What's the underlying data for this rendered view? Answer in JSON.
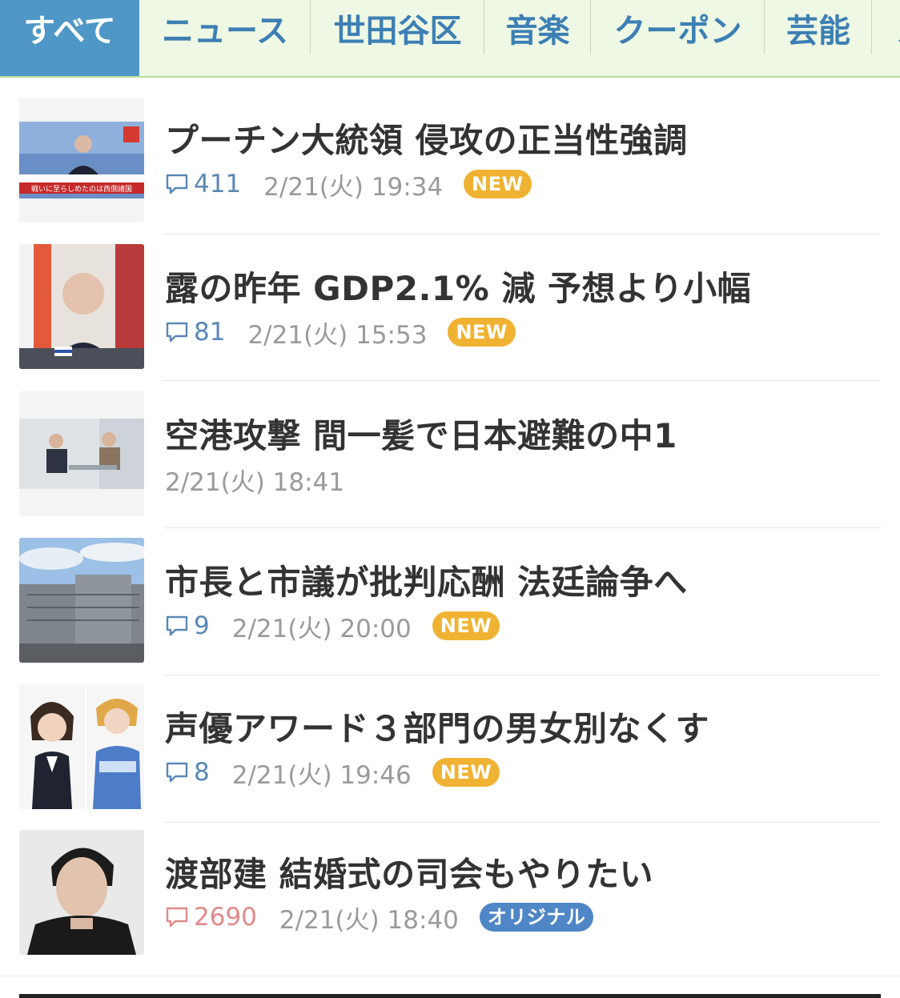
{
  "tabs": [
    {
      "label": "すべて",
      "active": true
    },
    {
      "label": "ニュース"
    },
    {
      "label": "世田谷区"
    },
    {
      "label": "音楽"
    },
    {
      "label": "クーポン"
    },
    {
      "label": "芸能"
    },
    {
      "label": "ス"
    }
  ],
  "articles": [
    {
      "title": "プーチン大統領 侵攻の正当性強調",
      "comments": "411",
      "date": "2/21(火) 19:34",
      "badge": "NEW",
      "thumb_caption": "戦いに至らしめたのは西側諸国"
    },
    {
      "title": "露の昨年 GDP2.1% 減 予想より小幅",
      "comments": "81",
      "date": "2/21(火) 15:53",
      "badge": "NEW"
    },
    {
      "title": "空港攻撃 間一髪で日本避難の中1",
      "comments": "",
      "date": "2/21(火) 18:41",
      "badge": ""
    },
    {
      "title": "市長と市議が批判応酬 法廷論争へ",
      "comments": "9",
      "date": "2/21(火) 20:00",
      "badge": "NEW"
    },
    {
      "title": "声優アワード３部門の男女別なくす",
      "comments": "8",
      "date": "2/21(火) 19:46",
      "badge": "NEW"
    },
    {
      "title": "渡部建 結婚式の司会もやりたい",
      "comments": "2690",
      "date": "2/21(火) 18:40",
      "badge": "オリジナル"
    }
  ],
  "colors": {
    "tab_active_bg": "#4e97c7",
    "tab_bar_bg": "#eef8e4",
    "tab_text": "#3d7fb4",
    "comment_blue": "#5a87b5",
    "comment_hot": "#e08a8a",
    "badge_new": "#f0b232",
    "badge_original": "#4f86c6"
  },
  "icons": {
    "comment": "speech-bubble-icon"
  }
}
